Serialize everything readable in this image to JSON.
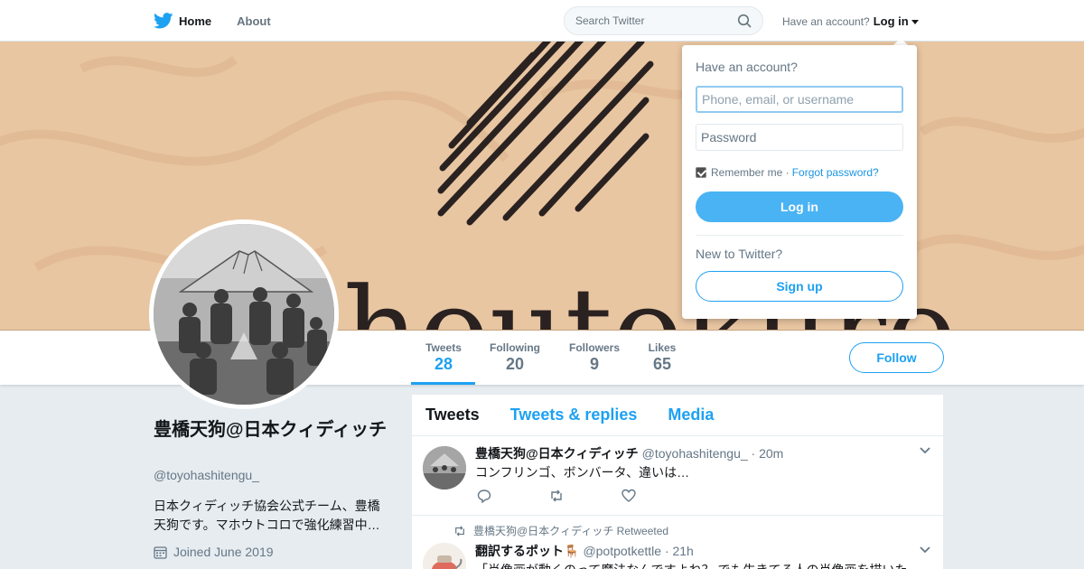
{
  "nav": {
    "home_label": "Home",
    "about_label": "About",
    "search_placeholder": "Search Twitter",
    "have_account": "Have an account?",
    "login_label": "Log in"
  },
  "banner": {
    "text": "houtokuro"
  },
  "profile_nav": {
    "stats": [
      {
        "label": "Tweets",
        "value": "28"
      },
      {
        "label": "Following",
        "value": "20"
      },
      {
        "label": "Followers",
        "value": "9"
      },
      {
        "label": "Likes",
        "value": "65"
      }
    ],
    "follow_label": "Follow"
  },
  "profile": {
    "name": "豊橋天狗@日本クィディッチ",
    "handle": "@toyohashitengu_",
    "bio": "日本クィディッチ協会公式チーム、豊橋天狗です。マホウトコロで強化練習中…",
    "joined": "Joined June 2019"
  },
  "timeline": {
    "tabs": [
      "Tweets",
      "Tweets & replies",
      "Media"
    ],
    "tweets": [
      {
        "name": "豊橋天狗@日本クィディッチ",
        "meta": "@toyohashitengu_ · 20m",
        "text": "コンフリンゴ、ボンバータ、違いは…"
      },
      {
        "retweeted_by": "豊橋天狗@日本クィディッチ Retweeted",
        "name": "翻訳するポット🪑",
        "meta": "@potpotkettle · 21h",
        "text": "「肖像画が動くのって魔法なんですよね？ でも生きてる人の肖像画を描いた"
      }
    ]
  },
  "login_dropdown": {
    "title": "Have an account?",
    "username_placeholder": "Phone, email, or username",
    "password_placeholder": "Password",
    "remember_label": "Remember me ·",
    "forgot_label": "Forgot password?",
    "login_button": "Log in",
    "new_label": "New to Twitter?",
    "signup_button": "Sign up"
  },
  "colors": {
    "accent": "#1da1f2",
    "banner_bg": "#e8c29d"
  }
}
